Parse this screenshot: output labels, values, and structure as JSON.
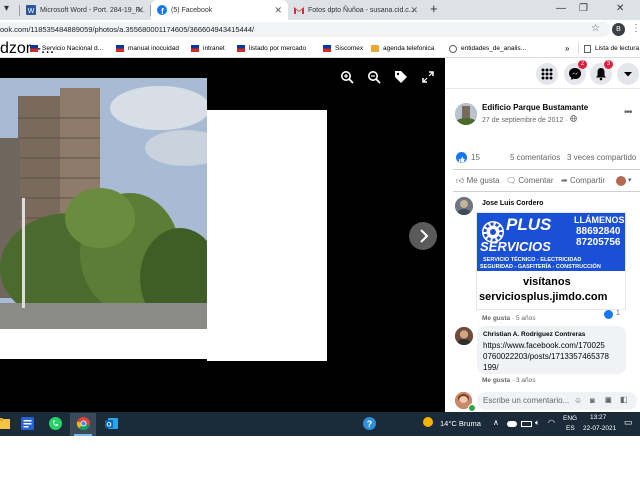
{
  "browser": {
    "tabs": [
      {
        "label": "Microsoft Word - Port. 284-19_F...",
        "icon": "word-icon"
      },
      {
        "label": "(5) Facebook",
        "icon": "facebook-icon"
      },
      {
        "label": "Fotos dpto Ñuñoa - susana.cid.c...",
        "icon": "gmail-icon"
      }
    ],
    "new_tab": "+",
    "url": "ook.com/118535484889059/photos/a.355680001174605/366604943415444/",
    "profile_initial": "B"
  },
  "bookmarks": {
    "items": [
      "dzor -...",
      "Servicio Nacional d...",
      "manual inocuidad",
      "intranet",
      "listado por mercado",
      "Siscomex",
      "agenda telefonica",
      "entidades_de_analis..."
    ],
    "more": "»",
    "reading_list": "Lista de lectura"
  },
  "notifications": {
    "messenger_count": "2",
    "alerts_count": "3"
  },
  "post": {
    "author": "Edificio Parque Bustamante",
    "date": "27 de septiembre de 2012 · ",
    "reaction_count": "15",
    "comment_count": "5 comentarios",
    "share_count": "3 veces compartido",
    "like_label": "Me gusta",
    "comment_label": "Comentar",
    "share_label": "Compartir"
  },
  "comments": [
    {
      "author": "Jose Luis Cordero",
      "like": "Me gusta",
      "time": "· 5 años",
      "reaction_count": "1",
      "ad": {
        "brand_top": "PLUS",
        "brand_bottom": "SERVICIOS",
        "call": "LLÁMENOS",
        "phone1": "88692840",
        "phone2": "87205756",
        "services": [
          "SERVICIO TÉCNICO - ELECTRICIDAD",
          "SEGURIDAD - GASFITERÍA - CONSTRUCCIÓN"
        ],
        "visit": "visítanos",
        "site": "serviciosplus.jimdo.com"
      }
    },
    {
      "author": "Christian A. Rodriguez Contreras",
      "text_lines": [
        "https://www.facebook.com/170025",
        "0760022203/posts/1713357465378",
        "199/"
      ],
      "like": "Me gusta",
      "time": "· 3 años"
    }
  ],
  "comment_input": {
    "placeholder": "Escribe un comentario..."
  },
  "taskbar": {
    "weather_temp": "14°C",
    "weather_desc": "Bruma",
    "lang": "ENG",
    "lang_region": "ES",
    "time": "13:27",
    "date": "22-07-2021"
  },
  "colors": {
    "facebook_blue": "#1877f2",
    "notification_red": "#e41e3f",
    "ad_blue": "#1a4fd8",
    "taskbar": "#1c2b3a"
  }
}
